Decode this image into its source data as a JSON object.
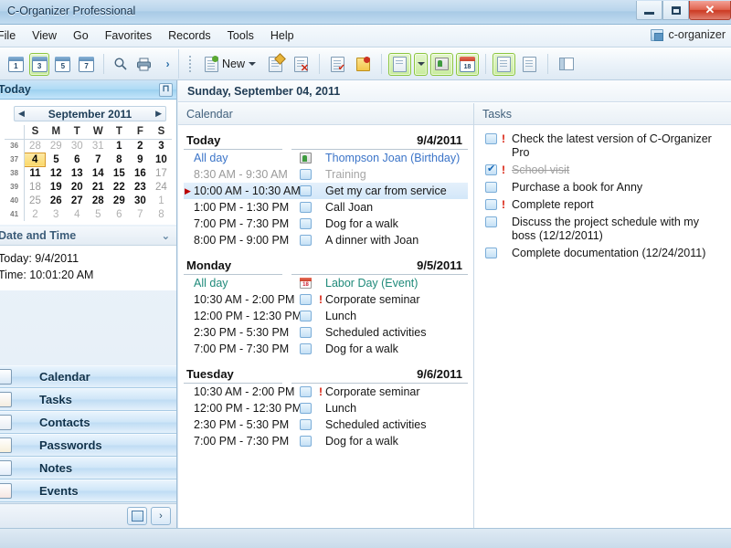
{
  "window": {
    "title": "C-Organizer Professional",
    "minimize_label": "Minimize",
    "maximize_label": "Maximize",
    "close_label": "✕"
  },
  "menubar": {
    "items": [
      {
        "label": "File"
      },
      {
        "label": "View"
      },
      {
        "label": "Go"
      },
      {
        "label": "Favorites"
      },
      {
        "label": "Records"
      },
      {
        "label": "Tools"
      },
      {
        "label": "Help"
      }
    ],
    "right_label": "c-organizer"
  },
  "toolbar": {
    "left_buttons": [
      {
        "name": "day-view-1",
        "label": "1",
        "selected": false
      },
      {
        "name": "day-view-3",
        "label": "3",
        "selected": true
      },
      {
        "name": "day-view-5",
        "label": "5",
        "selected": false
      },
      {
        "name": "day-view-7",
        "label": "7",
        "selected": false
      }
    ],
    "search_label": "Search",
    "print_label": "Print",
    "expand_label": "›",
    "new_label": "New",
    "right_buttons": [
      {
        "name": "edit-record-button",
        "label": "Edit record"
      },
      {
        "name": "delete-record-button",
        "label": "Delete record"
      },
      {
        "name": "task-list-button",
        "label": "Task list"
      },
      {
        "name": "note-button",
        "label": "Note"
      },
      {
        "name": "tasks-toggle-button",
        "label": "Tasks"
      },
      {
        "name": "contacts-button",
        "label": "Contacts"
      },
      {
        "name": "events-button",
        "label": "Events"
      },
      {
        "name": "filter-tasks-button",
        "label": "Filter tasks"
      },
      {
        "name": "print-preview-button",
        "label": "Print preview"
      },
      {
        "name": "layout-button",
        "label": "Layout"
      }
    ]
  },
  "sidebar": {
    "today_panel": {
      "title": "Today",
      "pin_label": "⊓"
    },
    "minical": {
      "prev_label": "◀",
      "next_label": "▶",
      "title": "September 2011",
      "weekday_headers": [
        "S",
        "M",
        "T",
        "W",
        "T",
        "F",
        "S"
      ],
      "week_numbers": [
        "36",
        "37",
        "38",
        "39",
        "40",
        "41"
      ],
      "weeks": [
        [
          {
            "d": "28",
            "s": "off"
          },
          {
            "d": "29",
            "s": "off"
          },
          {
            "d": "30",
            "s": "off"
          },
          {
            "d": "31",
            "s": "off"
          },
          {
            "d": "1",
            "s": ""
          },
          {
            "d": "2",
            "s": ""
          },
          {
            "d": "3",
            "s": ""
          }
        ],
        [
          {
            "d": "4",
            "s": "today"
          },
          {
            "d": "5",
            "s": ""
          },
          {
            "d": "6",
            "s": ""
          },
          {
            "d": "7",
            "s": ""
          },
          {
            "d": "8",
            "s": ""
          },
          {
            "d": "9",
            "s": ""
          },
          {
            "d": "10",
            "s": ""
          }
        ],
        [
          {
            "d": "11",
            "s": ""
          },
          {
            "d": "12",
            "s": ""
          },
          {
            "d": "13",
            "s": ""
          },
          {
            "d": "14",
            "s": ""
          },
          {
            "d": "15",
            "s": ""
          },
          {
            "d": "16",
            "s": ""
          },
          {
            "d": "17",
            "s": "dim"
          }
        ],
        [
          {
            "d": "18",
            "s": "dim"
          },
          {
            "d": "19",
            "s": ""
          },
          {
            "d": "20",
            "s": ""
          },
          {
            "d": "21",
            "s": ""
          },
          {
            "d": "22",
            "s": ""
          },
          {
            "d": "23",
            "s": ""
          },
          {
            "d": "24",
            "s": "dim"
          }
        ],
        [
          {
            "d": "25",
            "s": "dim"
          },
          {
            "d": "26",
            "s": ""
          },
          {
            "d": "27",
            "s": ""
          },
          {
            "d": "28",
            "s": ""
          },
          {
            "d": "29",
            "s": ""
          },
          {
            "d": "30",
            "s": ""
          },
          {
            "d": "1",
            "s": "off"
          }
        ],
        [
          {
            "d": "2",
            "s": "off"
          },
          {
            "d": "3",
            "s": "off"
          },
          {
            "d": "4",
            "s": "off"
          },
          {
            "d": "5",
            "s": "off"
          },
          {
            "d": "6",
            "s": "off"
          },
          {
            "d": "7",
            "s": "off"
          },
          {
            "d": "8",
            "s": "off"
          }
        ]
      ]
    },
    "datetime_panel": {
      "title": "Date and Time",
      "collapse_label": "⌄",
      "today_line": "Today: 9/4/2011",
      "time_line": "Time: 10:01:20 AM"
    },
    "nav_items": [
      {
        "label": "Calendar",
        "icon": "calendar-icon",
        "color": "#d8e8f6"
      },
      {
        "label": "Tasks",
        "icon": "tasks-icon",
        "color": "#f3ece0"
      },
      {
        "label": "Contacts",
        "icon": "contacts-icon",
        "color": "#e8eef4"
      },
      {
        "label": "Passwords",
        "icon": "passwords-icon",
        "color": "#f7f0da"
      },
      {
        "label": "Notes",
        "icon": "notes-icon",
        "color": "#e4eefa"
      },
      {
        "label": "Events",
        "icon": "events-icon",
        "color": "#f6e6e2"
      }
    ],
    "bottom": {
      "config_label": "Configure",
      "expand_label": "›"
    }
  },
  "main": {
    "day_header": "Sunday, September 04, 2011",
    "calendar_panel": {
      "title": "Calendar",
      "days": [
        {
          "name": "Today",
          "date": "9/4/2011",
          "events": [
            {
              "time": "All day",
              "time_style": "allday",
              "text": "Thompson Joan (Birthday)",
              "text_style": "link",
              "icon": "contact-icon",
              "priority": false,
              "selected": false,
              "marker": false
            },
            {
              "time": "8:30 AM - 9:30 AM",
              "time_style": "dim",
              "text": "Training",
              "text_style": "dim",
              "icon": "event-box-icon",
              "priority": false,
              "selected": false,
              "marker": false
            },
            {
              "time": "10:00 AM - 10:30 AM",
              "time_style": "",
              "text": "Get my car from service",
              "text_style": "",
              "icon": "event-box-icon",
              "priority": false,
              "selected": true,
              "marker": true
            },
            {
              "time": "1:00 PM - 1:30 PM",
              "time_style": "",
              "text": "Call Joan",
              "text_style": "",
              "icon": "event-box-icon",
              "priority": false,
              "selected": false,
              "marker": false
            },
            {
              "time": "7:00 PM - 7:30 PM",
              "time_style": "",
              "text": "Dog for a walk",
              "text_style": "",
              "icon": "event-box-icon",
              "priority": false,
              "selected": false,
              "marker": false
            },
            {
              "time": "8:00 PM - 9:00 PM",
              "time_style": "",
              "text": "A dinner with Joan",
              "text_style": "",
              "icon": "event-box-icon",
              "priority": false,
              "selected": false,
              "marker": false
            }
          ]
        },
        {
          "name": "Monday",
          "date": "9/5/2011",
          "events": [
            {
              "time": "All day",
              "time_style": "allday green",
              "text": "Labor Day (Event)",
              "text_style": "green",
              "icon": "event-date-icon",
              "priority": false,
              "selected": false,
              "marker": false
            },
            {
              "time": "10:30 AM - 2:00 PM",
              "time_style": "",
              "text": "Corporate seminar",
              "text_style": "",
              "icon": "event-box-icon",
              "priority": true,
              "selected": false,
              "marker": false
            },
            {
              "time": "12:00 PM - 12:30 PM",
              "time_style": "",
              "text": "Lunch",
              "text_style": "",
              "icon": "event-box-icon",
              "priority": false,
              "selected": false,
              "marker": false
            },
            {
              "time": "2:30 PM - 5:30 PM",
              "time_style": "",
              "text": "Scheduled activities",
              "text_style": "",
              "icon": "event-box-icon",
              "priority": false,
              "selected": false,
              "marker": false
            },
            {
              "time": "7:00 PM - 7:30 PM",
              "time_style": "",
              "text": "Dog for a walk",
              "text_style": "",
              "icon": "event-box-icon",
              "priority": false,
              "selected": false,
              "marker": false
            }
          ]
        },
        {
          "name": "Tuesday",
          "date": "9/6/2011",
          "events": [
            {
              "time": "10:30 AM - 2:00 PM",
              "time_style": "",
              "text": "Corporate seminar",
              "text_style": "",
              "icon": "event-box-icon",
              "priority": true,
              "selected": false,
              "marker": false
            },
            {
              "time": "12:00 PM - 12:30 PM",
              "time_style": "",
              "text": "Lunch",
              "text_style": "",
              "icon": "event-box-icon",
              "priority": false,
              "selected": false,
              "marker": false
            },
            {
              "time": "2:30 PM - 5:30 PM",
              "time_style": "",
              "text": "Scheduled activities",
              "text_style": "",
              "icon": "event-box-icon",
              "priority": false,
              "selected": false,
              "marker": false
            },
            {
              "time": "7:00 PM - 7:30 PM",
              "time_style": "",
              "text": "Dog for a walk",
              "text_style": "",
              "icon": "event-box-icon",
              "priority": false,
              "selected": false,
              "marker": false
            }
          ]
        }
      ]
    },
    "tasks_panel": {
      "title": "Tasks",
      "items": [
        {
          "text": "Check the latest version of C-Organizer Pro",
          "checked": false,
          "priority": true,
          "done": false
        },
        {
          "text": "School visit",
          "checked": true,
          "priority": true,
          "done": true
        },
        {
          "text": "Purchase a book for Anny",
          "checked": false,
          "priority": false,
          "done": false
        },
        {
          "text": "Complete report",
          "checked": false,
          "priority": true,
          "done": false
        },
        {
          "text": "Discuss the project schedule with my boss (12/12/2011)",
          "checked": false,
          "priority": false,
          "done": false
        },
        {
          "text": "Complete documentation (12/24/2011)",
          "checked": false,
          "priority": false,
          "done": false
        }
      ]
    }
  },
  "colors": {
    "accent_blue": "#3b74c8",
    "title_blue": "#15405f",
    "priority_red": "#d81b09",
    "today_highlight": "#fbd96a",
    "selected_row": "#d3e7f9",
    "green_event": "#1f8a7a"
  }
}
